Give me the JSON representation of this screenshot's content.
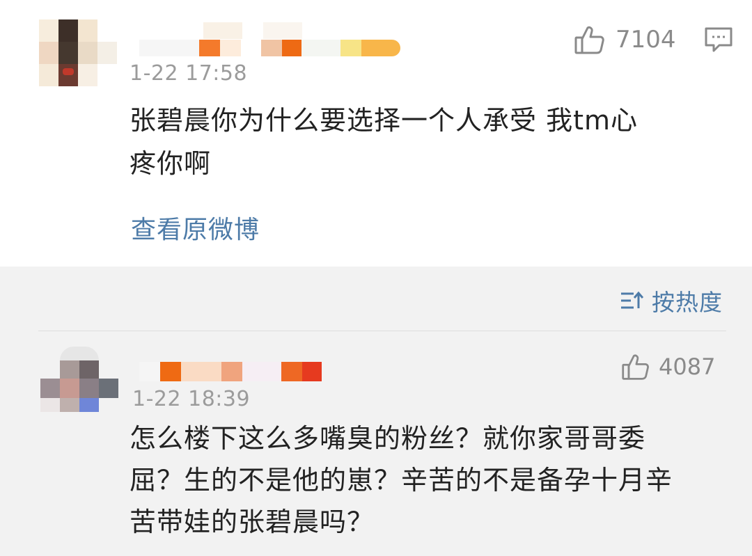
{
  "comments": [
    {
      "time": "1-22 17:58",
      "likes": "7104",
      "text_lines": [
        "张碧晨你为什么要选择一个人承受 我tm心",
        "疼你啊"
      ],
      "view_original_label": "查看原微博",
      "name_colors": [
        "#f6f6f6",
        "#fdecdc",
        "#f47a2b",
        "#fbe6d5",
        "#f0c4a4",
        "#ee6a14",
        "#f4f6f2",
        "#f7e487",
        "#f8b64a"
      ]
    },
    {
      "time": "1-22 18:39",
      "likes": "4087",
      "text_lines": [
        "怎么楼下这么多嘴臭的粉丝？就你家哥哥委",
        "屈？生的不是他的崽？辛苦的不是备孕十月辛",
        "苦带娃的张碧晨吗？"
      ],
      "name_colors": [
        "#f5f5f5",
        "#ef6a13",
        "#fadbc4",
        "#f0a47e",
        "#f6eef4",
        "#ee6824",
        "#e63a1f"
      ]
    }
  ],
  "sort": {
    "label": "按热度"
  },
  "colors": {
    "link": "#4d7ba8",
    "time": "#9b9b9b",
    "text": "#222222",
    "bottom_bg": "#f2f2f2"
  },
  "icons": [
    "thumbs-up-icon",
    "reply-comment-icon",
    "sort-icon"
  ]
}
